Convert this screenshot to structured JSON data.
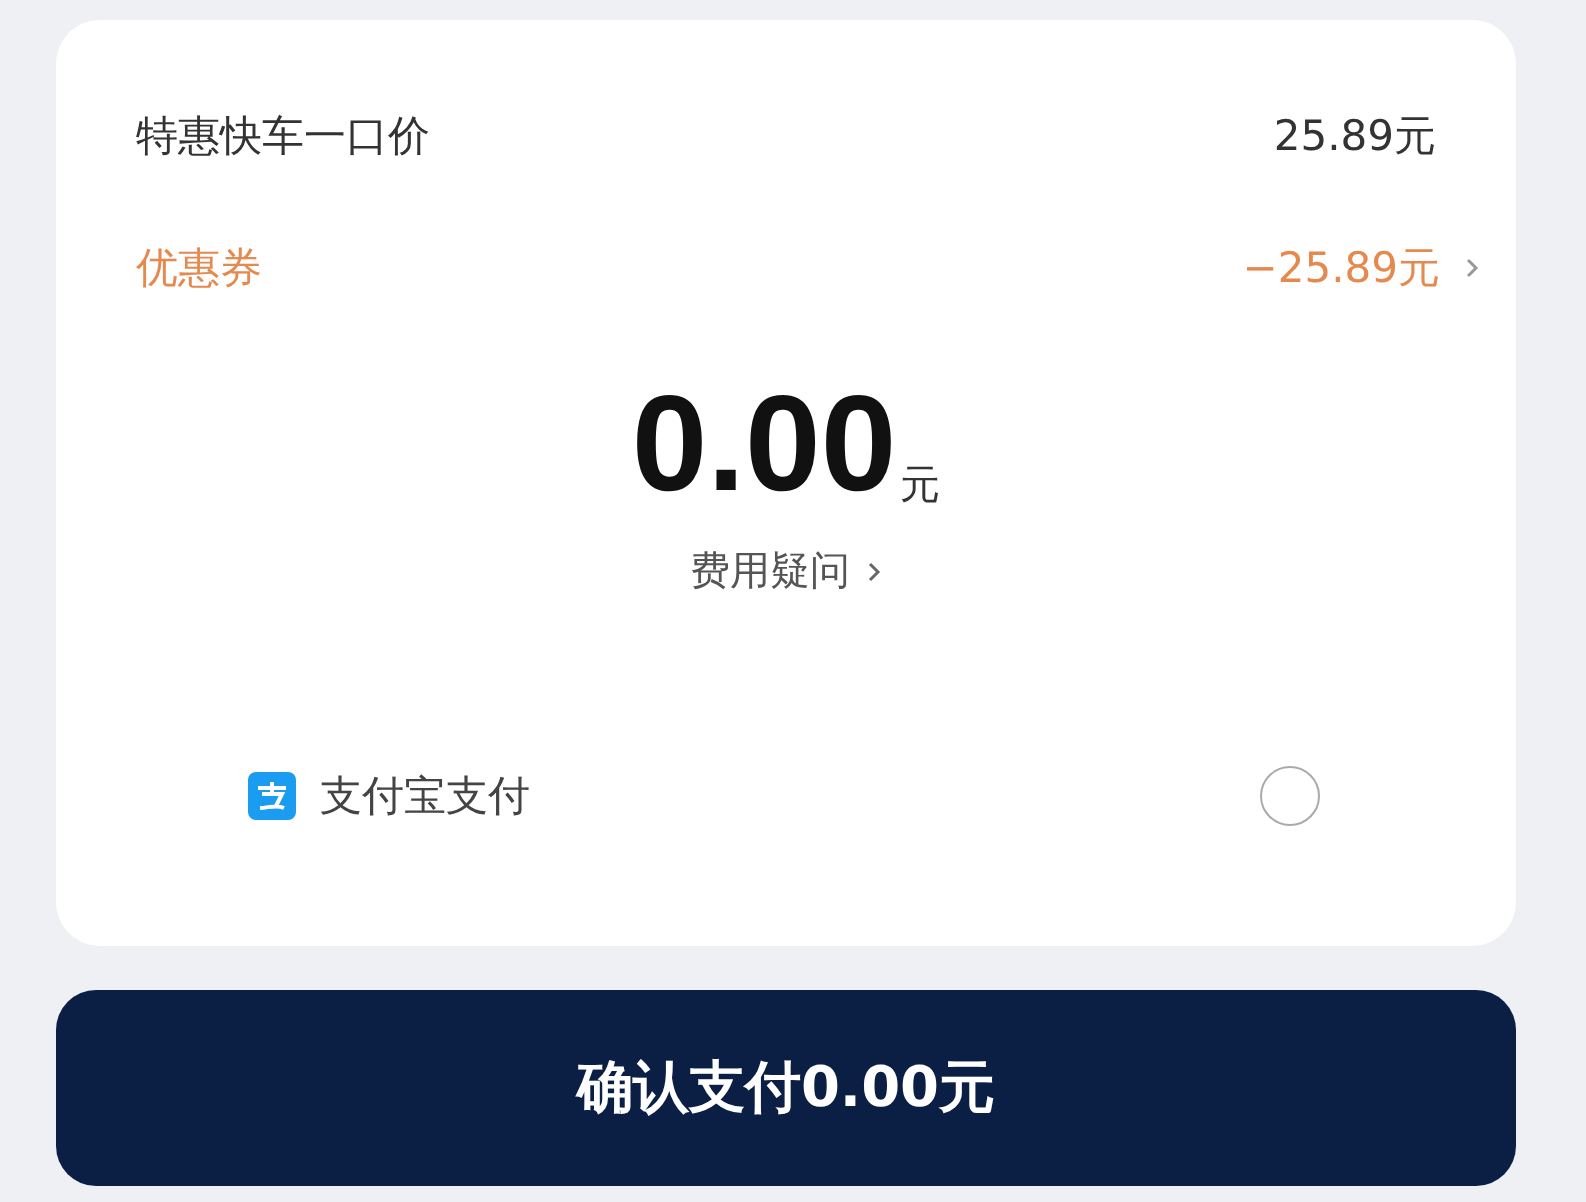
{
  "fare": {
    "label": "特惠快车一口价",
    "value": "25.89元"
  },
  "coupon": {
    "label": "优惠券",
    "value": "−25.89元"
  },
  "total": {
    "amount": "0.00",
    "unit": "元"
  },
  "fee_question": "费用疑问",
  "payment_methods": [
    {
      "label": "支付宝支付",
      "selected": false
    }
  ],
  "confirm_button": "确认支付0.00元"
}
